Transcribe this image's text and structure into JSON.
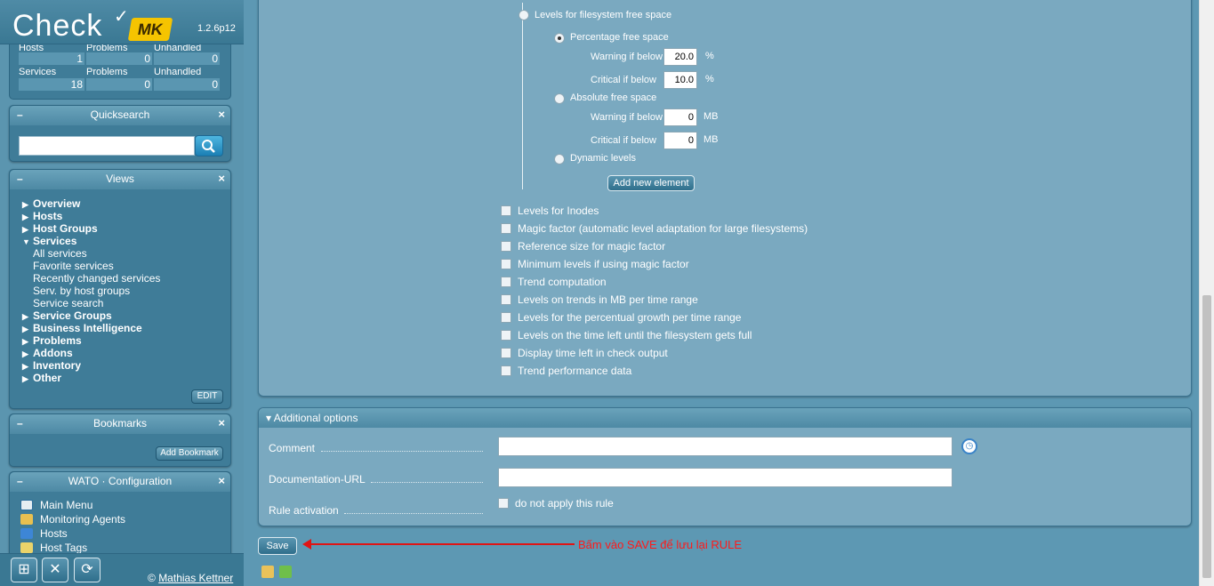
{
  "logo": {
    "text": "Check",
    "mk": "MK",
    "version": "1.2.6p12"
  },
  "tactical": {
    "headers_row1": [
      "Hosts",
      "Problems",
      "Unhandled"
    ],
    "values_row1": [
      "1",
      "0",
      "0"
    ],
    "headers_row2": [
      "Services",
      "Problems",
      "Unhandled"
    ],
    "values_row2": [
      "18",
      "0",
      "0"
    ]
  },
  "quicksearch": {
    "title": "Quicksearch",
    "minus": "–",
    "close": "×",
    "placeholder": ""
  },
  "views": {
    "title": "Views",
    "minus": "–",
    "close": "×",
    "items": [
      {
        "label": "Overview",
        "arrow": "▶",
        "level": "top"
      },
      {
        "label": "Hosts",
        "arrow": "▶",
        "level": "top"
      },
      {
        "label": "Host Groups",
        "arrow": "▶",
        "level": "top"
      },
      {
        "label": "Services",
        "arrow": "▼",
        "level": "top"
      },
      {
        "label": "All services",
        "arrow": "",
        "level": "sub"
      },
      {
        "label": "Favorite services",
        "arrow": "",
        "level": "sub"
      },
      {
        "label": "Recently changed services",
        "arrow": "",
        "level": "sub"
      },
      {
        "label": "Serv. by host groups",
        "arrow": "",
        "level": "sub"
      },
      {
        "label": "Service search",
        "arrow": "",
        "level": "sub"
      },
      {
        "label": "Service Groups",
        "arrow": "▶",
        "level": "top"
      },
      {
        "label": "Business Intelligence",
        "arrow": "▶",
        "level": "top"
      },
      {
        "label": "Problems",
        "arrow": "▶",
        "level": "top"
      },
      {
        "label": "Addons",
        "arrow": "▶",
        "level": "top"
      },
      {
        "label": "Inventory",
        "arrow": "▶",
        "level": "top"
      },
      {
        "label": "Other",
        "arrow": "▶",
        "level": "top"
      }
    ],
    "edit_label": "EDIT"
  },
  "bookmarks": {
    "title": "Bookmarks",
    "minus": "–",
    "close": "×",
    "add_label": "Add Bookmark"
  },
  "wato": {
    "title": "WATO · Configuration",
    "minus": "–",
    "close": "×",
    "items": [
      {
        "label": "Main Menu",
        "icon": "home-icon"
      },
      {
        "label": "Monitoring Agents",
        "icon": "agents-icon"
      },
      {
        "label": "Hosts",
        "icon": "hosts-icon"
      },
      {
        "label": "Host Tags",
        "icon": "tags-icon"
      }
    ]
  },
  "footer": {
    "buttons": [
      "add-snapin-icon",
      "settings-icon",
      "logout-icon"
    ],
    "copyright_symbol": "©",
    "copyright_name": "Mathias Kettner"
  },
  "rule": {
    "levels_fs": "Levels for filesystem free space",
    "pct_free": "Percentage free space",
    "warn_below": "Warning if below",
    "crit_below": "Critical if below",
    "pct_warn_value": "20.0",
    "pct_crit_value": "10.0",
    "pct_unit": "%",
    "abs_free": "Absolute free space",
    "abs_warn_value": "0",
    "abs_crit_value": "0",
    "abs_unit": "MB",
    "dynamic_levels": "Dynamic levels",
    "add_element": "Add new element",
    "checkbox_options": [
      "Levels for Inodes",
      "Magic factor (automatic level adaptation for large filesystems)",
      "Reference size for magic factor",
      "Minimum levels if using magic factor",
      "Trend computation",
      "Levels on trends in MB per time range",
      "Levels for the percentual growth per time range",
      "Levels on the time left until the filesystem gets full",
      "Display time left in check output",
      "Trend performance data"
    ]
  },
  "additional": {
    "title": "Additional options",
    "comment_label": "Comment",
    "doc_url_label": "Documentation-URL",
    "activation_label": "Rule activation",
    "do_not_apply": "do not apply this rule",
    "comment_value": "",
    "doc_url_value": ""
  },
  "save_label": "Save",
  "annotation": "Bấm vào SAVE để lưu lại RULE",
  "colors": {
    "annotation": "#ff1a1a",
    "accent": "#3f7c98"
  }
}
